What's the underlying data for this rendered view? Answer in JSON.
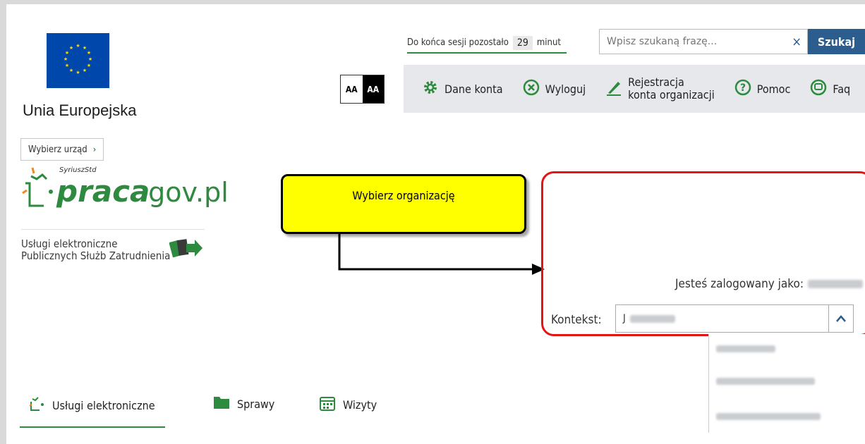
{
  "header": {
    "eu_label": "Unia Europejska",
    "choose_office_label": "Wybierz urząd",
    "logo": {
      "superscript": "SyriuszStd",
      "main": "praca",
      "domain": ".gov.pl"
    },
    "services_line1": "Usługi elektroniczne",
    "services_line2": "Publicznych Służb Zatrudnienia"
  },
  "session": {
    "prefix": "Do końca sesji pozostało",
    "minutes": "29",
    "suffix": "minut"
  },
  "search": {
    "placeholder": "Wpisz szukaną frazę...",
    "clear_symbol": "×",
    "button_label": "Szukaj"
  },
  "contrast": {
    "normal_label": "AA",
    "high_label": "AA"
  },
  "toolbar": {
    "account": "Dane konta",
    "logout": "Wyloguj",
    "register_line1": "Rejestracja",
    "register_line2": "konta organizacji",
    "help": "Pomoc",
    "faq": "Faq"
  },
  "callout": {
    "text": "Wybierz organizację"
  },
  "user": {
    "logged_as": "Jesteś zalogowany jako:",
    "context_label": "Kontekst:",
    "context_initial": "J"
  },
  "nav": {
    "services": "Usługi elektroniczne",
    "cases": "Sprawy",
    "visits": "Wizyty"
  },
  "colors": {
    "accent_green": "#2d8a3e",
    "search_blue": "#2b5e8e",
    "eu_blue": "#0047ab",
    "highlight_red": "#e21414",
    "callout_yellow": "#ffff00"
  }
}
